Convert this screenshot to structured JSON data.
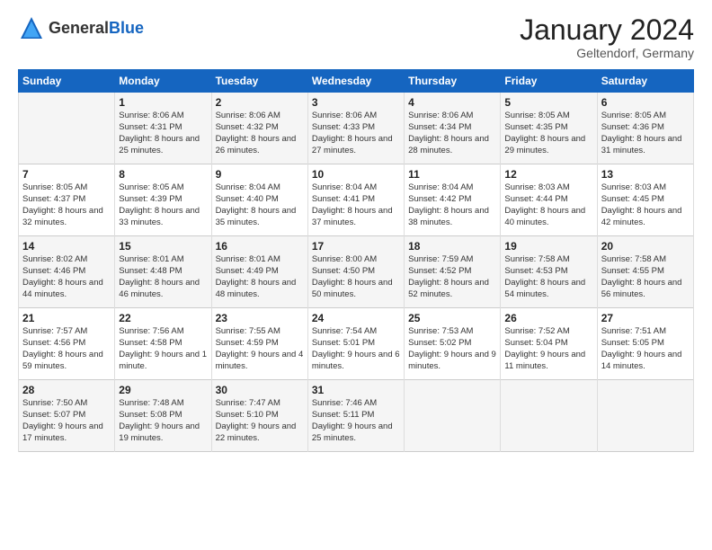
{
  "header": {
    "logo_general": "General",
    "logo_blue": "Blue",
    "month_title": "January 2024",
    "location": "Geltendorf, Germany"
  },
  "days_of_week": [
    "Sunday",
    "Monday",
    "Tuesday",
    "Wednesday",
    "Thursday",
    "Friday",
    "Saturday"
  ],
  "weeks": [
    [
      {
        "day": "",
        "sunrise": "",
        "sunset": "",
        "daylight": ""
      },
      {
        "day": "1",
        "sunrise": "Sunrise: 8:06 AM",
        "sunset": "Sunset: 4:31 PM",
        "daylight": "Daylight: 8 hours and 25 minutes."
      },
      {
        "day": "2",
        "sunrise": "Sunrise: 8:06 AM",
        "sunset": "Sunset: 4:32 PM",
        "daylight": "Daylight: 8 hours and 26 minutes."
      },
      {
        "day": "3",
        "sunrise": "Sunrise: 8:06 AM",
        "sunset": "Sunset: 4:33 PM",
        "daylight": "Daylight: 8 hours and 27 minutes."
      },
      {
        "day": "4",
        "sunrise": "Sunrise: 8:06 AM",
        "sunset": "Sunset: 4:34 PM",
        "daylight": "Daylight: 8 hours and 28 minutes."
      },
      {
        "day": "5",
        "sunrise": "Sunrise: 8:05 AM",
        "sunset": "Sunset: 4:35 PM",
        "daylight": "Daylight: 8 hours and 29 minutes."
      },
      {
        "day": "6",
        "sunrise": "Sunrise: 8:05 AM",
        "sunset": "Sunset: 4:36 PM",
        "daylight": "Daylight: 8 hours and 31 minutes."
      }
    ],
    [
      {
        "day": "7",
        "sunrise": "Sunrise: 8:05 AM",
        "sunset": "Sunset: 4:37 PM",
        "daylight": "Daylight: 8 hours and 32 minutes."
      },
      {
        "day": "8",
        "sunrise": "Sunrise: 8:05 AM",
        "sunset": "Sunset: 4:39 PM",
        "daylight": "Daylight: 8 hours and 33 minutes."
      },
      {
        "day": "9",
        "sunrise": "Sunrise: 8:04 AM",
        "sunset": "Sunset: 4:40 PM",
        "daylight": "Daylight: 8 hours and 35 minutes."
      },
      {
        "day": "10",
        "sunrise": "Sunrise: 8:04 AM",
        "sunset": "Sunset: 4:41 PM",
        "daylight": "Daylight: 8 hours and 37 minutes."
      },
      {
        "day": "11",
        "sunrise": "Sunrise: 8:04 AM",
        "sunset": "Sunset: 4:42 PM",
        "daylight": "Daylight: 8 hours and 38 minutes."
      },
      {
        "day": "12",
        "sunrise": "Sunrise: 8:03 AM",
        "sunset": "Sunset: 4:44 PM",
        "daylight": "Daylight: 8 hours and 40 minutes."
      },
      {
        "day": "13",
        "sunrise": "Sunrise: 8:03 AM",
        "sunset": "Sunset: 4:45 PM",
        "daylight": "Daylight: 8 hours and 42 minutes."
      }
    ],
    [
      {
        "day": "14",
        "sunrise": "Sunrise: 8:02 AM",
        "sunset": "Sunset: 4:46 PM",
        "daylight": "Daylight: 8 hours and 44 minutes."
      },
      {
        "day": "15",
        "sunrise": "Sunrise: 8:01 AM",
        "sunset": "Sunset: 4:48 PM",
        "daylight": "Daylight: 8 hours and 46 minutes."
      },
      {
        "day": "16",
        "sunrise": "Sunrise: 8:01 AM",
        "sunset": "Sunset: 4:49 PM",
        "daylight": "Daylight: 8 hours and 48 minutes."
      },
      {
        "day": "17",
        "sunrise": "Sunrise: 8:00 AM",
        "sunset": "Sunset: 4:50 PM",
        "daylight": "Daylight: 8 hours and 50 minutes."
      },
      {
        "day": "18",
        "sunrise": "Sunrise: 7:59 AM",
        "sunset": "Sunset: 4:52 PM",
        "daylight": "Daylight: 8 hours and 52 minutes."
      },
      {
        "day": "19",
        "sunrise": "Sunrise: 7:58 AM",
        "sunset": "Sunset: 4:53 PM",
        "daylight": "Daylight: 8 hours and 54 minutes."
      },
      {
        "day": "20",
        "sunrise": "Sunrise: 7:58 AM",
        "sunset": "Sunset: 4:55 PM",
        "daylight": "Daylight: 8 hours and 56 minutes."
      }
    ],
    [
      {
        "day": "21",
        "sunrise": "Sunrise: 7:57 AM",
        "sunset": "Sunset: 4:56 PM",
        "daylight": "Daylight: 8 hours and 59 minutes."
      },
      {
        "day": "22",
        "sunrise": "Sunrise: 7:56 AM",
        "sunset": "Sunset: 4:58 PM",
        "daylight": "Daylight: 9 hours and 1 minute."
      },
      {
        "day": "23",
        "sunrise": "Sunrise: 7:55 AM",
        "sunset": "Sunset: 4:59 PM",
        "daylight": "Daylight: 9 hours and 4 minutes."
      },
      {
        "day": "24",
        "sunrise": "Sunrise: 7:54 AM",
        "sunset": "Sunset: 5:01 PM",
        "daylight": "Daylight: 9 hours and 6 minutes."
      },
      {
        "day": "25",
        "sunrise": "Sunrise: 7:53 AM",
        "sunset": "Sunset: 5:02 PM",
        "daylight": "Daylight: 9 hours and 9 minutes."
      },
      {
        "day": "26",
        "sunrise": "Sunrise: 7:52 AM",
        "sunset": "Sunset: 5:04 PM",
        "daylight": "Daylight: 9 hours and 11 minutes."
      },
      {
        "day": "27",
        "sunrise": "Sunrise: 7:51 AM",
        "sunset": "Sunset: 5:05 PM",
        "daylight": "Daylight: 9 hours and 14 minutes."
      }
    ],
    [
      {
        "day": "28",
        "sunrise": "Sunrise: 7:50 AM",
        "sunset": "Sunset: 5:07 PM",
        "daylight": "Daylight: 9 hours and 17 minutes."
      },
      {
        "day": "29",
        "sunrise": "Sunrise: 7:48 AM",
        "sunset": "Sunset: 5:08 PM",
        "daylight": "Daylight: 9 hours and 19 minutes."
      },
      {
        "day": "30",
        "sunrise": "Sunrise: 7:47 AM",
        "sunset": "Sunset: 5:10 PM",
        "daylight": "Daylight: 9 hours and 22 minutes."
      },
      {
        "day": "31",
        "sunrise": "Sunrise: 7:46 AM",
        "sunset": "Sunset: 5:11 PM",
        "daylight": "Daylight: 9 hours and 25 minutes."
      },
      {
        "day": "",
        "sunrise": "",
        "sunset": "",
        "daylight": ""
      },
      {
        "day": "",
        "sunrise": "",
        "sunset": "",
        "daylight": ""
      },
      {
        "day": "",
        "sunrise": "",
        "sunset": "",
        "daylight": ""
      }
    ]
  ]
}
